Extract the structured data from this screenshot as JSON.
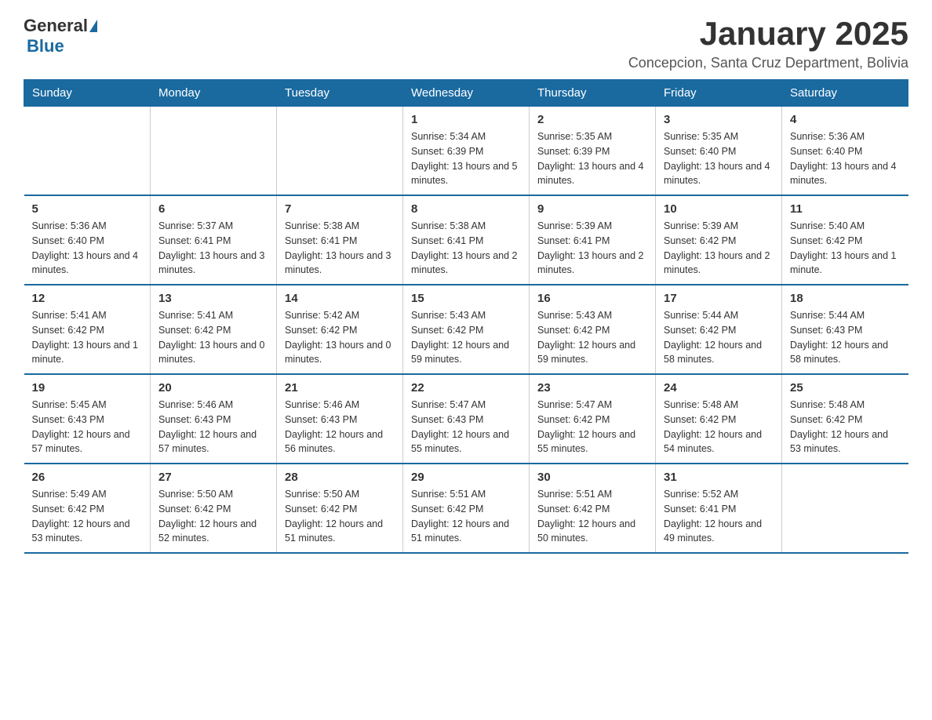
{
  "logo": {
    "general": "General",
    "blue": "Blue"
  },
  "title": "January 2025",
  "subtitle": "Concepcion, Santa Cruz Department, Bolivia",
  "days_of_week": [
    "Sunday",
    "Monday",
    "Tuesday",
    "Wednesday",
    "Thursday",
    "Friday",
    "Saturday"
  ],
  "weeks": [
    [
      {
        "day": "",
        "info": ""
      },
      {
        "day": "",
        "info": ""
      },
      {
        "day": "",
        "info": ""
      },
      {
        "day": "1",
        "info": "Sunrise: 5:34 AM\nSunset: 6:39 PM\nDaylight: 13 hours and 5 minutes."
      },
      {
        "day": "2",
        "info": "Sunrise: 5:35 AM\nSunset: 6:39 PM\nDaylight: 13 hours and 4 minutes."
      },
      {
        "day": "3",
        "info": "Sunrise: 5:35 AM\nSunset: 6:40 PM\nDaylight: 13 hours and 4 minutes."
      },
      {
        "day": "4",
        "info": "Sunrise: 5:36 AM\nSunset: 6:40 PM\nDaylight: 13 hours and 4 minutes."
      }
    ],
    [
      {
        "day": "5",
        "info": "Sunrise: 5:36 AM\nSunset: 6:40 PM\nDaylight: 13 hours and 4 minutes."
      },
      {
        "day": "6",
        "info": "Sunrise: 5:37 AM\nSunset: 6:41 PM\nDaylight: 13 hours and 3 minutes."
      },
      {
        "day": "7",
        "info": "Sunrise: 5:38 AM\nSunset: 6:41 PM\nDaylight: 13 hours and 3 minutes."
      },
      {
        "day": "8",
        "info": "Sunrise: 5:38 AM\nSunset: 6:41 PM\nDaylight: 13 hours and 2 minutes."
      },
      {
        "day": "9",
        "info": "Sunrise: 5:39 AM\nSunset: 6:41 PM\nDaylight: 13 hours and 2 minutes."
      },
      {
        "day": "10",
        "info": "Sunrise: 5:39 AM\nSunset: 6:42 PM\nDaylight: 13 hours and 2 minutes."
      },
      {
        "day": "11",
        "info": "Sunrise: 5:40 AM\nSunset: 6:42 PM\nDaylight: 13 hours and 1 minute."
      }
    ],
    [
      {
        "day": "12",
        "info": "Sunrise: 5:41 AM\nSunset: 6:42 PM\nDaylight: 13 hours and 1 minute."
      },
      {
        "day": "13",
        "info": "Sunrise: 5:41 AM\nSunset: 6:42 PM\nDaylight: 13 hours and 0 minutes."
      },
      {
        "day": "14",
        "info": "Sunrise: 5:42 AM\nSunset: 6:42 PM\nDaylight: 13 hours and 0 minutes."
      },
      {
        "day": "15",
        "info": "Sunrise: 5:43 AM\nSunset: 6:42 PM\nDaylight: 12 hours and 59 minutes."
      },
      {
        "day": "16",
        "info": "Sunrise: 5:43 AM\nSunset: 6:42 PM\nDaylight: 12 hours and 59 minutes."
      },
      {
        "day": "17",
        "info": "Sunrise: 5:44 AM\nSunset: 6:42 PM\nDaylight: 12 hours and 58 minutes."
      },
      {
        "day": "18",
        "info": "Sunrise: 5:44 AM\nSunset: 6:43 PM\nDaylight: 12 hours and 58 minutes."
      }
    ],
    [
      {
        "day": "19",
        "info": "Sunrise: 5:45 AM\nSunset: 6:43 PM\nDaylight: 12 hours and 57 minutes."
      },
      {
        "day": "20",
        "info": "Sunrise: 5:46 AM\nSunset: 6:43 PM\nDaylight: 12 hours and 57 minutes."
      },
      {
        "day": "21",
        "info": "Sunrise: 5:46 AM\nSunset: 6:43 PM\nDaylight: 12 hours and 56 minutes."
      },
      {
        "day": "22",
        "info": "Sunrise: 5:47 AM\nSunset: 6:43 PM\nDaylight: 12 hours and 55 minutes."
      },
      {
        "day": "23",
        "info": "Sunrise: 5:47 AM\nSunset: 6:42 PM\nDaylight: 12 hours and 55 minutes."
      },
      {
        "day": "24",
        "info": "Sunrise: 5:48 AM\nSunset: 6:42 PM\nDaylight: 12 hours and 54 minutes."
      },
      {
        "day": "25",
        "info": "Sunrise: 5:48 AM\nSunset: 6:42 PM\nDaylight: 12 hours and 53 minutes."
      }
    ],
    [
      {
        "day": "26",
        "info": "Sunrise: 5:49 AM\nSunset: 6:42 PM\nDaylight: 12 hours and 53 minutes."
      },
      {
        "day": "27",
        "info": "Sunrise: 5:50 AM\nSunset: 6:42 PM\nDaylight: 12 hours and 52 minutes."
      },
      {
        "day": "28",
        "info": "Sunrise: 5:50 AM\nSunset: 6:42 PM\nDaylight: 12 hours and 51 minutes."
      },
      {
        "day": "29",
        "info": "Sunrise: 5:51 AM\nSunset: 6:42 PM\nDaylight: 12 hours and 51 minutes."
      },
      {
        "day": "30",
        "info": "Sunrise: 5:51 AM\nSunset: 6:42 PM\nDaylight: 12 hours and 50 minutes."
      },
      {
        "day": "31",
        "info": "Sunrise: 5:52 AM\nSunset: 6:41 PM\nDaylight: 12 hours and 49 minutes."
      },
      {
        "day": "",
        "info": ""
      }
    ]
  ]
}
